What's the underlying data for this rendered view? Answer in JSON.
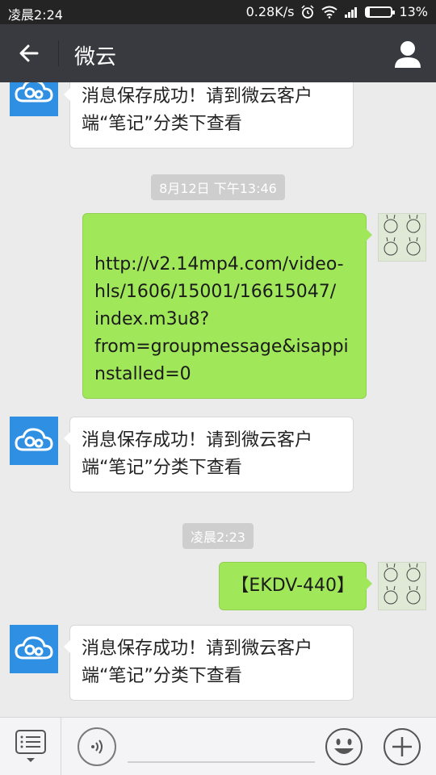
{
  "status_bar": {
    "time": "凌晨2:24",
    "network_speed": "0.28K/s",
    "battery": "13%",
    "battery_level": 0.13,
    "icons": [
      "alarm-icon",
      "wifi-icon",
      "signal-icon",
      "battery-icon"
    ]
  },
  "header": {
    "title": "微云",
    "back_icon": "back-arrow-icon",
    "profile_icon": "person-icon"
  },
  "messages": [
    {
      "side": "left",
      "sender_icon": "weiyun-cloud-icon",
      "lines": [
        "消息保存成功！请到微云客户",
        "端“笔记”分类下查看"
      ]
    },
    {
      "type": "timestamp",
      "text": "8月12日 下午13:46"
    },
    {
      "side": "right",
      "lines": [
        "",
        "http://v2.14mp4.com/video-",
        "hls/1606/15001/16615047/",
        "index.m3u8?",
        "from=groupmessage&isappi",
        "nstalled=0"
      ]
    },
    {
      "side": "left",
      "sender_icon": "weiyun-cloud-icon",
      "lines": [
        "消息保存成功！请到微云客户",
        "端“笔记”分类下查看"
      ]
    },
    {
      "type": "timestamp",
      "text": "凌晨2:23"
    },
    {
      "side": "right",
      "lines": [
        "【EKDV-440】"
      ]
    },
    {
      "side": "left",
      "sender_icon": "weiyun-cloud-icon",
      "lines": [
        "消息保存成功！请到微云客户",
        "端“笔记”分类下查看"
      ]
    }
  ],
  "input_bar": {
    "menu_icon": "list-menu-icon",
    "voice_icon": "voice-icon",
    "text_value": "",
    "emoji_icon": "emoji-icon",
    "plus_icon": "plus-icon"
  },
  "colors": {
    "header_bg": "#393a3f",
    "chat_bg": "#ebebeb",
    "sent_bubble": "#a0e75a",
    "received_bubble": "#ffffff",
    "weiyun_blue": "#2f8fe2"
  }
}
